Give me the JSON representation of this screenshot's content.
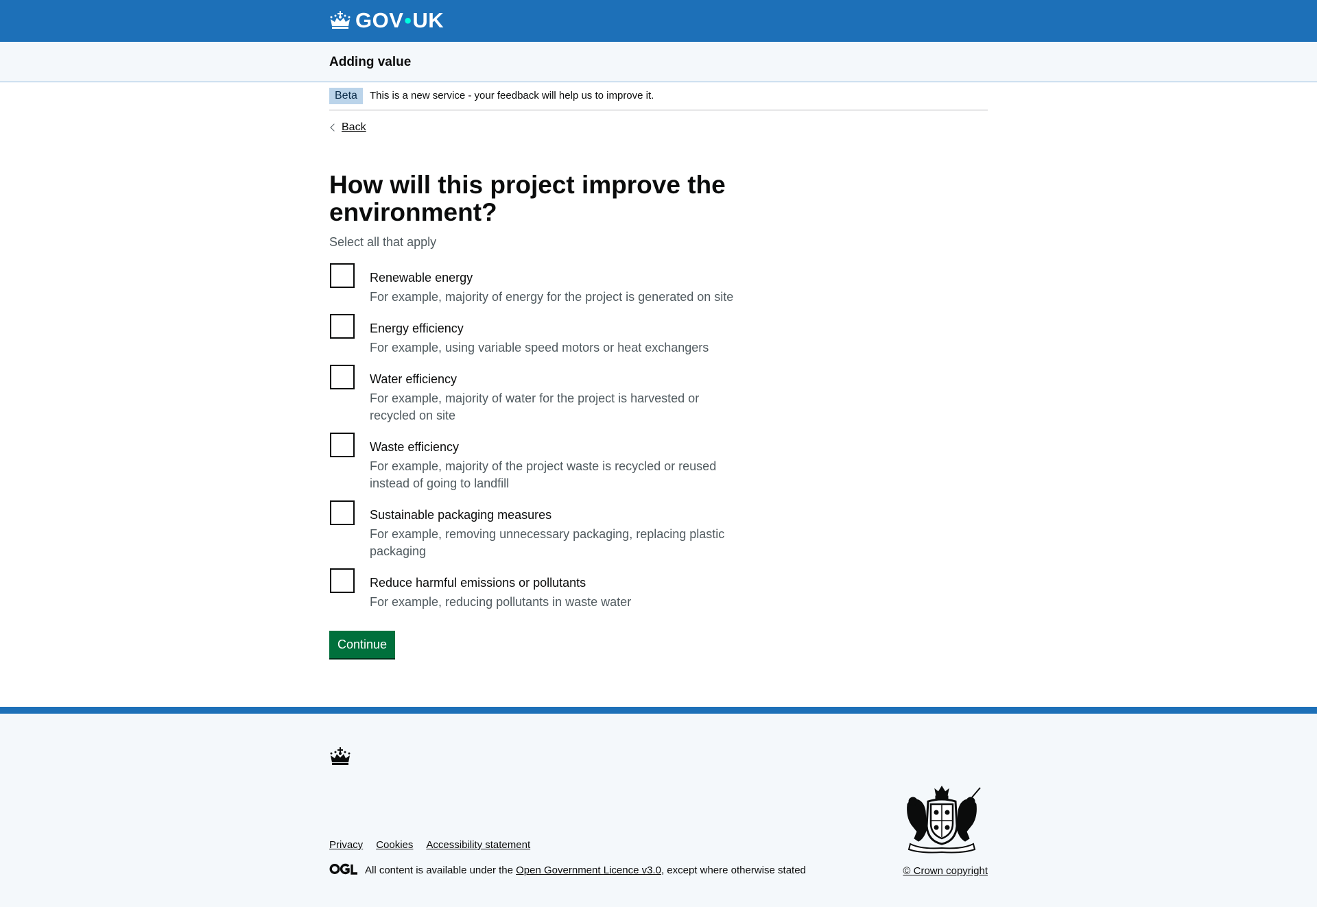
{
  "header": {
    "logo_gov": "GOV",
    "logo_dot": "•",
    "logo_uk": "UK",
    "logo_icon": "crown-icon",
    "background_color": "#1d70b8"
  },
  "service": {
    "name": "Adding value"
  },
  "phase_banner": {
    "tag": "Beta",
    "text": "This is a new service - your feedback will help us to improve it."
  },
  "back_link": {
    "label": "Back",
    "icon": "chevron-left-icon"
  },
  "question": {
    "title": "How will this project improve the environment?",
    "hint": "Select all that apply",
    "options": [
      {
        "label": "Renewable energy",
        "example": "For example, majority of energy for the project is generated on site",
        "checked": false
      },
      {
        "label": "Energy efficiency",
        "example": "For example, using variable speed motors or heat exchangers",
        "checked": false
      },
      {
        "label": "Water efficiency",
        "example": "For example, majority of water for the project is harvested or recycled on site",
        "checked": false
      },
      {
        "label": "Waste efficiency",
        "example": "For example, majority of the project waste is recycled or reused instead of going to landfill",
        "checked": false
      },
      {
        "label": "Sustainable packaging measures",
        "example": "For example, removing unnecessary packaging, replacing plastic packaging",
        "checked": false
      },
      {
        "label": "Reduce harmful emissions or pollutants",
        "example": "For example, reducing pollutants in waste water",
        "checked": false
      }
    ]
  },
  "continue_button": {
    "label": "Continue",
    "color": "#00703c"
  },
  "footer": {
    "links": [
      "Privacy",
      "Cookies",
      "Accessibility statement"
    ],
    "licence_prefix": "All content is available under the ",
    "licence_link": "Open Government Licence v3.0",
    "licence_suffix": ", except where otherwise stated",
    "copyright": "© Crown copyright",
    "ogl_icon": "ogl-logo-icon",
    "crown_icon": "crown-icon",
    "coat_of_arms_icon": "royal-coat-of-arms-icon"
  }
}
